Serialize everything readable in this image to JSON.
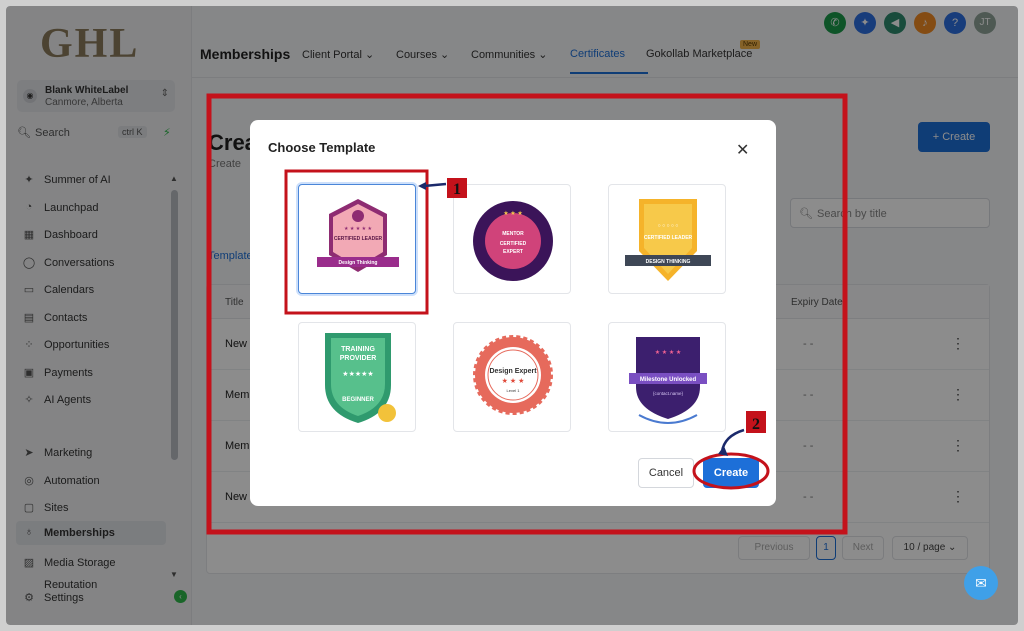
{
  "brand": {
    "logo_text": "GHL"
  },
  "account": {
    "name": "Blank WhiteLabel",
    "location": "Canmore, Alberta"
  },
  "sidebar_search": {
    "placeholder": "Search",
    "shortcut": "ctrl K"
  },
  "sidebar": {
    "items": [
      {
        "label": "Summer of AI",
        "icon": "sparkle-icon"
      },
      {
        "label": "Launchpad",
        "icon": "rocket-icon"
      },
      {
        "label": "Dashboard",
        "icon": "dashboard-icon"
      },
      {
        "label": "Conversations",
        "icon": "chat-icon"
      },
      {
        "label": "Calendars",
        "icon": "calendar-icon"
      },
      {
        "label": "Contacts",
        "icon": "contacts-icon"
      },
      {
        "label": "Opportunities",
        "icon": "opportunities-icon"
      },
      {
        "label": "Payments",
        "icon": "payments-icon"
      },
      {
        "label": "AI Agents",
        "icon": "ai-agents-icon"
      },
      {
        "label": "Marketing",
        "icon": "marketing-icon"
      },
      {
        "label": "Automation",
        "icon": "automation-icon"
      },
      {
        "label": "Sites",
        "icon": "sites-icon"
      },
      {
        "label": "Memberships",
        "icon": "memberships-icon",
        "active": true
      },
      {
        "label": "Media Storage",
        "icon": "media-icon"
      },
      {
        "label": "Reputation",
        "icon": "reputation-icon"
      },
      {
        "label": "Settings",
        "icon": "gear-icon"
      }
    ]
  },
  "topnav": {
    "title": "Memberships",
    "tabs": [
      "Client Portal",
      "Courses",
      "Communities",
      "Certificates",
      "Gokollab Marketplace"
    ],
    "active_tab": "Certificates",
    "new_badge": "New"
  },
  "main": {
    "title": "Crea",
    "subtitle": "Create",
    "create_button": "Create",
    "search_placeholder": "Search by title",
    "tab_label": "Template",
    "table": {
      "headers": [
        "Title",
        "Expiry Date"
      ],
      "rows": [
        {
          "title": "New",
          "expiry": "- -"
        },
        {
          "title": "Mem",
          "expiry": "- -"
        },
        {
          "title": "Mem",
          "expiry": "- -"
        },
        {
          "title": "New",
          "expiry": "- -"
        }
      ]
    },
    "pagination": {
      "prev": "Previous",
      "page": "1",
      "next": "Next",
      "per_page": "10 / page"
    }
  },
  "modal": {
    "title": "Choose Template",
    "templates": [
      {
        "id": "t1",
        "lines": [
          "CERTIFIED LEADER",
          "Design Thinking"
        ],
        "selected": true
      },
      {
        "id": "t2",
        "lines": [
          "MENTOR",
          "CERTIFIED",
          "EXPERT"
        ]
      },
      {
        "id": "t3",
        "lines": [
          "CERTIFIED LEADER",
          "DESIGN THINKING"
        ]
      },
      {
        "id": "t4",
        "lines": [
          "TRAINING",
          "PROVIDER",
          "BEGINNER"
        ]
      },
      {
        "id": "t5",
        "lines": [
          "Design Expert",
          "Level 1"
        ]
      },
      {
        "id": "t6",
        "lines": [
          "Milestone Unlocked",
          "{contact.name}"
        ]
      }
    ],
    "cancel": "Cancel",
    "create": "Create"
  },
  "annotations": {
    "step1": "1",
    "step2": "2"
  },
  "colors": {
    "accent": "#1d6fd8",
    "annotation_red": "#c4121b",
    "success": "#2eb84a"
  }
}
